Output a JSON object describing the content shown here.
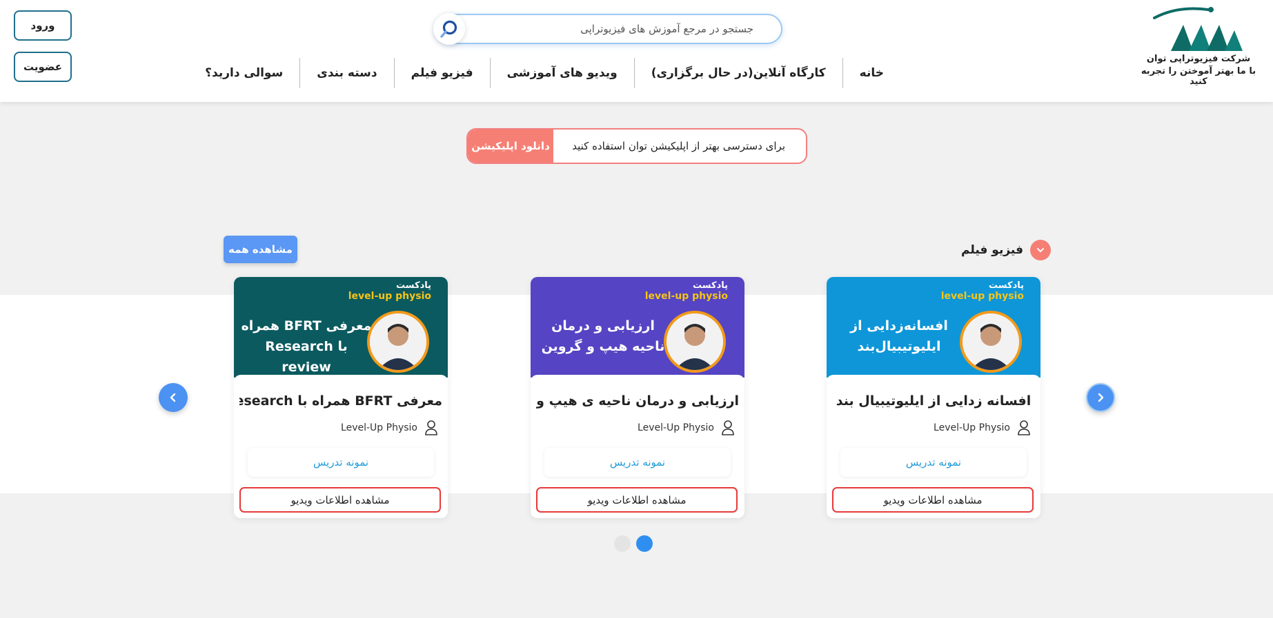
{
  "header": {
    "company_name": "شرکت فیزیوتراپی توان",
    "tagline": "با ما بهتر آموختن را تجربه کنید",
    "search_placeholder": "جستجو در مرجع آموزش های فیزیوتراپی",
    "login_label": "ورود",
    "signup_label": "عضویت",
    "nav": [
      {
        "label": "خانه"
      },
      {
        "label": "کارگاه آنلاین(در حال برگزاری)"
      },
      {
        "label": "ویدیو های آموزشی"
      },
      {
        "label": "فیزیو فیلم"
      },
      {
        "label": "دسته بندی"
      },
      {
        "label": "سوالی دارید؟"
      }
    ]
  },
  "app_banner": {
    "text": "برای دسترسی بهتر از اپلیکیشن توان استفاده کنید",
    "button_label": "دانلود اپلیکیشن",
    "accent_color": "#f67f75"
  },
  "section": {
    "title": "فیزیو فیلم",
    "view_all_label": "مشاهده همه",
    "cards": [
      {
        "thumb_caption1": "پادکست",
        "thumb_caption2": "level-up physio",
        "thumb_title": "افسانه‌زدایی از ایلیوتیبیال‌بند",
        "thumb_color": "#0e96d8",
        "title": "افسانه زدایی از ایلیوتیبیال بند",
        "author": "Level-Up Physio",
        "sample_label": "نمونه تدریس",
        "info_label": "مشاهده اطلاعات ویدیو"
      },
      {
        "thumb_caption1": "پادکست",
        "thumb_caption2": "level-up physio",
        "thumb_title": "ارزیابی و درمان ناحیه هیپ و گروین",
        "thumb_color": "#5544c3",
        "title": "ارزیابی و درمان ناحیه ی هیپ و گروی",
        "author": "Level-Up Physio",
        "sample_label": "نمونه تدریس",
        "info_label": "مشاهده اطلاعات ویدیو"
      },
      {
        "thumb_caption1": "پادکست",
        "thumb_caption2": "level-up physio",
        "thumb_title": "معرفی BFRT همراه با Research review",
        "thumb_color": "#0b5a5f",
        "title": "معرفی BFRT همراه با Research...",
        "author": "Level-Up Physio",
        "sample_label": "نمونه تدریس",
        "info_label": "مشاهده اطلاعات ویدیو"
      }
    ],
    "pagination": {
      "pages": 2,
      "active": 1
    }
  },
  "colors": {
    "primary_blue": "#4b92f2",
    "brand_teal": "#0f6b66",
    "danger_red": "#e63a3a",
    "link_blue": "#1e9bd7"
  }
}
